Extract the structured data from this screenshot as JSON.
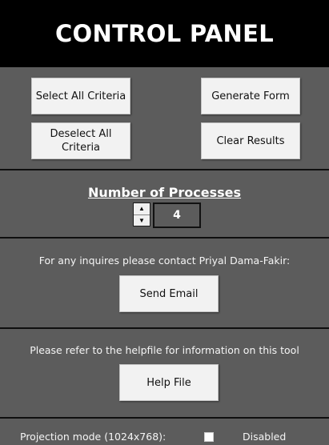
{
  "header": {
    "title": "CONTROL PANEL"
  },
  "criteria": {
    "select_all_label": "Select All Criteria",
    "deselect_all_label": "Deselect All Criteria",
    "generate_form_label": "Generate Form",
    "clear_results_label": "Clear Results"
  },
  "processes": {
    "heading": "Number of Processes",
    "value": "4",
    "up_glyph": "▲",
    "down_glyph": "▼"
  },
  "contact": {
    "text": "For any inquires please contact Priyal Dama-Fakir:",
    "send_email_label": "Send Email"
  },
  "help": {
    "text": "Please refer to the helpfile for information on this tool",
    "help_file_label": "Help File"
  },
  "projection": {
    "label": "Projection mode (1024x768):",
    "status": "Disabled",
    "checked": false
  },
  "colors": {
    "panel_bg": "#5c5c5c",
    "title_bg": "#000000",
    "button_bg": "#f2f2f2",
    "text": "#ffffff"
  }
}
